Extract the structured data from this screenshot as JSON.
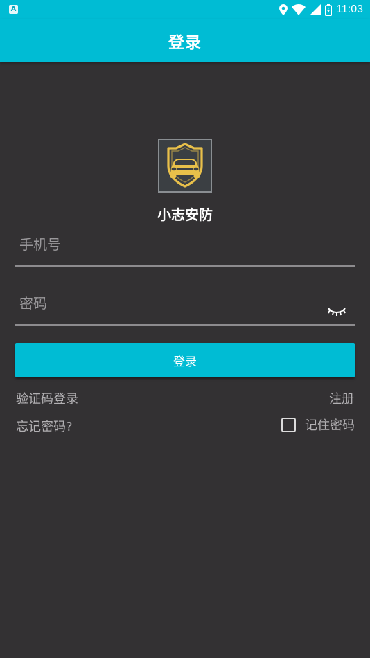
{
  "status_bar": {
    "notification_icon": "A",
    "time": "11:03",
    "icons": [
      "location-icon",
      "wifi-icon",
      "cell-signal-icon",
      "battery-icon"
    ]
  },
  "app_bar": {
    "title": "登录"
  },
  "logo": {
    "name": "小志安防",
    "icon": "car-shield-icon"
  },
  "form": {
    "phone_placeholder": "手机号",
    "password_placeholder": "密码",
    "login_button": "登录"
  },
  "links": {
    "sms_login": "验证码登录",
    "register": "注册",
    "forgot_password": "忘记密码?",
    "remember_password": "记住密码"
  },
  "colors": {
    "accent": "#00bcd4",
    "background": "#333133",
    "logo_gold": "#e8c04a"
  }
}
